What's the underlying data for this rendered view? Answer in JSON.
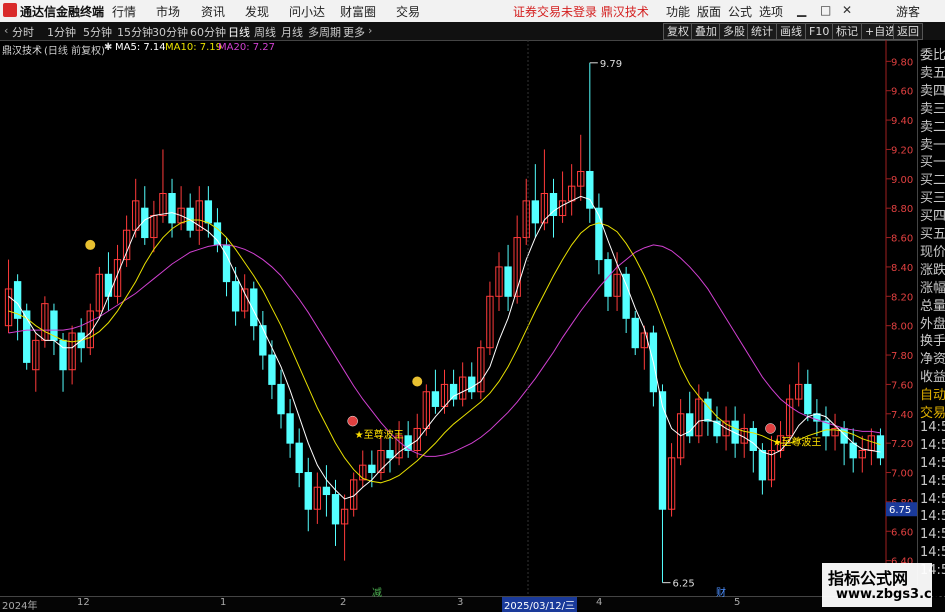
{
  "app": {
    "name": "通达信金融终端",
    "notice": "证券交易未登录  鼎汉技术"
  },
  "menu": [
    "行情",
    "市场",
    "资讯",
    "发现",
    "问小达",
    "财富圈",
    "交易"
  ],
  "right_menu": [
    "功能",
    "版面",
    "公式",
    "选项"
  ],
  "guest_label": "游客",
  "periods": [
    "分时",
    "1分钟",
    "5分钟",
    "15分钟",
    "30分钟",
    "60分钟",
    "日线",
    "周线",
    "月线",
    "多周期",
    "更多"
  ],
  "active_period": "日线",
  "tool_buttons": [
    "复权",
    "叠加",
    "多股",
    "统计",
    "画线",
    "F10",
    "标记",
    "+自选",
    "返回"
  ],
  "indicator": {
    "stock": "鼎汉技术",
    "mode": "(日线 前复权)",
    "ma5": "MA5: 7.14",
    "ma10": "MA10: 7.19",
    "ma20": "MA20: 7.27"
  },
  "colors": {
    "up": "#ff3b3b",
    "down": "#54ffff",
    "ma5": "#ffffff",
    "ma10": "#e8e000",
    "ma20": "#d040d0",
    "axis": "#e04040"
  },
  "price_axis": [
    "9.80",
    "9.60",
    "9.40",
    "9.20",
    "9.00",
    "8.80",
    "8.60",
    "8.40",
    "8.20",
    "8.00",
    "7.80",
    "7.60",
    "7.40",
    "7.20",
    "7.00",
    "6.80",
    "6.60",
    "6.40",
    "6.20"
  ],
  "annotations": {
    "high": "9.79",
    "low": "6.25",
    "signal": "★至尊波王",
    "current_price": "6.75"
  },
  "side_panel": [
    "委比",
    "卖五",
    "卖四",
    "卖三",
    "卖二",
    "卖一",
    "买一",
    "买二",
    "买三",
    "买四",
    "买五",
    "现价",
    "涨跌",
    "涨幅",
    "总量",
    "外盘",
    "换手",
    "净资",
    "收益",
    "自动",
    "交易",
    "14:56",
    "14:56",
    "14:56",
    "14:56",
    "14:56",
    "14:56",
    "14:56",
    "14:56",
    "14:56"
  ],
  "bottom_dates": [
    "2024年",
    "12",
    "1",
    "2",
    "3",
    "2025/03/12/三",
    "4",
    "5"
  ],
  "bottom_marks": [
    "减",
    "财"
  ],
  "watermark": {
    "line1": "指标公式网",
    "line2": "www.zbgs3.com"
  },
  "chart_data": {
    "type": "candlestick",
    "ylim": [
      6.2,
      9.85
    ],
    "series_names": [
      "MA5",
      "MA10",
      "MA20"
    ],
    "candles": [
      [
        8.0,
        8.25,
        8.45,
        7.95
      ],
      [
        8.3,
        8.05,
        8.35,
        7.9
      ],
      [
        8.1,
        7.75,
        8.15,
        7.7
      ],
      [
        7.7,
        7.9,
        7.95,
        7.55
      ],
      [
        7.9,
        8.15,
        8.2,
        7.85
      ],
      [
        8.1,
        7.9,
        8.15,
        7.8
      ],
      [
        7.9,
        7.7,
        7.95,
        7.55
      ],
      [
        7.7,
        7.95,
        8.0,
        7.6
      ],
      [
        7.95,
        7.85,
        8.05,
        7.75
      ],
      [
        7.85,
        8.1,
        8.15,
        7.8
      ],
      [
        8.1,
        8.35,
        8.4,
        8.05
      ],
      [
        8.35,
        8.2,
        8.5,
        8.1
      ],
      [
        8.2,
        8.45,
        8.55,
        8.15
      ],
      [
        8.45,
        8.65,
        8.75,
        8.4
      ],
      [
        8.65,
        8.85,
        9.0,
        8.6
      ],
      [
        8.8,
        8.6,
        8.95,
        8.55
      ],
      [
        8.6,
        8.75,
        8.85,
        8.5
      ],
      [
        8.75,
        8.9,
        9.2,
        8.7
      ],
      [
        8.9,
        8.7,
        9.0,
        8.6
      ],
      [
        8.7,
        8.8,
        8.95,
        8.65
      ],
      [
        8.8,
        8.65,
        8.9,
        8.6
      ],
      [
        8.65,
        8.85,
        8.95,
        8.55
      ],
      [
        8.85,
        8.7,
        8.95,
        8.6
      ],
      [
        8.7,
        8.55,
        8.8,
        8.5
      ],
      [
        8.55,
        8.3,
        8.6,
        8.2
      ],
      [
        8.3,
        8.1,
        8.4,
        8.0
      ],
      [
        8.1,
        8.25,
        8.35,
        8.05
      ],
      [
        8.25,
        8.0,
        8.3,
        7.9
      ],
      [
        8.0,
        7.8,
        8.1,
        7.7
      ],
      [
        7.8,
        7.6,
        7.9,
        7.5
      ],
      [
        7.6,
        7.4,
        7.7,
        7.3
      ],
      [
        7.4,
        7.2,
        7.5,
        7.1
      ],
      [
        7.2,
        7.0,
        7.3,
        6.9
      ],
      [
        7.0,
        6.75,
        7.1,
        6.6
      ],
      [
        6.75,
        6.9,
        7.0,
        6.65
      ],
      [
        6.9,
        6.85,
        7.05,
        6.7
      ],
      [
        6.85,
        6.65,
        6.95,
        6.5
      ],
      [
        6.65,
        6.75,
        6.85,
        6.4
      ],
      [
        6.75,
        6.95,
        7.0,
        6.7
      ],
      [
        6.95,
        7.05,
        7.15,
        6.9
      ],
      [
        7.05,
        7.0,
        7.15,
        6.9
      ],
      [
        7.0,
        7.15,
        7.25,
        6.95
      ],
      [
        7.15,
        7.1,
        7.25,
        7.0
      ],
      [
        7.1,
        7.25,
        7.35,
        7.05
      ],
      [
        7.25,
        7.15,
        7.35,
        7.1
      ],
      [
        7.15,
        7.3,
        7.4,
        7.1
      ],
      [
        7.3,
        7.55,
        7.6,
        7.25
      ],
      [
        7.55,
        7.45,
        7.7,
        7.4
      ],
      [
        7.45,
        7.6,
        7.7,
        7.4
      ],
      [
        7.6,
        7.5,
        7.7,
        7.45
      ],
      [
        7.5,
        7.65,
        7.75,
        7.45
      ],
      [
        7.65,
        7.55,
        7.75,
        7.5
      ],
      [
        7.55,
        7.85,
        7.9,
        7.5
      ],
      [
        7.85,
        8.2,
        8.3,
        7.8
      ],
      [
        8.2,
        8.4,
        8.5,
        8.1
      ],
      [
        8.4,
        8.2,
        8.55,
        8.1
      ],
      [
        8.2,
        8.6,
        8.75,
        8.15
      ],
      [
        8.6,
        8.85,
        9.0,
        8.55
      ],
      [
        8.85,
        8.7,
        9.1,
        8.6
      ],
      [
        8.7,
        8.9,
        9.2,
        8.65
      ],
      [
        8.9,
        8.75,
        9.0,
        8.6
      ],
      [
        8.75,
        8.85,
        9.05,
        8.7
      ],
      [
        8.85,
        8.95,
        9.1,
        8.75
      ],
      [
        8.95,
        9.05,
        9.3,
        8.85
      ],
      [
        9.05,
        8.8,
        9.79,
        8.7
      ],
      [
        8.8,
        8.45,
        8.9,
        8.35
      ],
      [
        8.45,
        8.2,
        8.5,
        8.1
      ],
      [
        8.2,
        8.35,
        8.5,
        8.1
      ],
      [
        8.35,
        8.05,
        8.4,
        7.95
      ],
      [
        8.05,
        7.85,
        8.1,
        7.8
      ],
      [
        7.85,
        7.95,
        8.0,
        7.7
      ],
      [
        7.95,
        7.55,
        8.0,
        7.45
      ],
      [
        7.55,
        6.75,
        7.6,
        6.25
      ],
      [
        6.75,
        7.1,
        7.2,
        6.7
      ],
      [
        7.1,
        7.4,
        7.5,
        7.05
      ],
      [
        7.4,
        7.25,
        7.55,
        7.2
      ],
      [
        7.25,
        7.5,
        7.6,
        7.2
      ],
      [
        7.5,
        7.35,
        7.55,
        7.25
      ],
      [
        7.35,
        7.25,
        7.45,
        7.2
      ],
      [
        7.25,
        7.35,
        7.45,
        7.15
      ],
      [
        7.35,
        7.2,
        7.45,
        7.1
      ],
      [
        7.2,
        7.3,
        7.4,
        7.1
      ],
      [
        7.3,
        7.15,
        7.35,
        7.0
      ],
      [
        7.15,
        6.95,
        7.2,
        6.85
      ],
      [
        6.95,
        7.15,
        7.25,
        6.9
      ],
      [
        7.15,
        7.25,
        7.35,
        7.1
      ],
      [
        7.25,
        7.5,
        7.6,
        7.2
      ],
      [
        7.5,
        7.6,
        7.75,
        7.45
      ],
      [
        7.6,
        7.4,
        7.7,
        7.35
      ],
      [
        7.4,
        7.35,
        7.5,
        7.25
      ],
      [
        7.35,
        7.25,
        7.45,
        7.15
      ],
      [
        7.25,
        7.3,
        7.4,
        7.15
      ],
      [
        7.3,
        7.2,
        7.35,
        7.05
      ],
      [
        7.2,
        7.1,
        7.3,
        7.0
      ],
      [
        7.1,
        7.15,
        7.25,
        7.0
      ],
      [
        7.15,
        7.25,
        7.3,
        7.05
      ],
      [
        7.25,
        7.1,
        7.3,
        7.05
      ]
    ],
    "ma5": [
      8.2,
      8.15,
      8.05,
      7.95,
      7.9,
      7.9,
      7.85,
      7.85,
      7.9,
      7.95,
      8.05,
      8.2,
      8.35,
      8.5,
      8.65,
      8.72,
      8.75,
      8.76,
      8.77,
      8.75,
      8.72,
      8.68,
      8.64,
      8.58,
      8.48,
      8.35,
      8.22,
      8.1,
      7.98,
      7.85,
      7.72,
      7.56,
      7.38,
      7.2,
      7.05,
      6.95,
      6.88,
      6.82,
      6.84,
      6.9,
      6.95,
      7.02,
      7.08,
      7.14,
      7.18,
      7.22,
      7.3,
      7.38,
      7.45,
      7.52,
      7.55,
      7.58,
      7.62,
      7.72,
      7.9,
      8.05,
      8.25,
      8.45,
      8.6,
      8.72,
      8.78,
      8.82,
      8.85,
      8.88,
      8.86,
      8.75,
      8.58,
      8.42,
      8.28,
      8.12,
      7.98,
      7.75,
      7.45,
      7.3,
      7.25,
      7.28,
      7.35,
      7.36,
      7.34,
      7.3,
      7.27,
      7.24,
      7.2,
      7.14,
      7.12,
      7.15,
      7.22,
      7.32,
      7.38,
      7.4,
      7.38,
      7.32,
      7.26,
      7.2,
      7.16,
      7.15,
      7.14
    ],
    "ma10": [
      8.1,
      8.08,
      8.05,
      8.0,
      7.96,
      7.93,
      7.9,
      7.89,
      7.9,
      7.92,
      7.96,
      8.02,
      8.1,
      8.2,
      8.3,
      8.42,
      8.52,
      8.6,
      8.66,
      8.7,
      8.72,
      8.72,
      8.7,
      8.66,
      8.6,
      8.52,
      8.43,
      8.34,
      8.24,
      8.12,
      8.0,
      7.86,
      7.72,
      7.58,
      7.44,
      7.32,
      7.2,
      7.1,
      7.02,
      6.96,
      6.94,
      6.93,
      6.95,
      6.98,
      7.03,
      7.08,
      7.14,
      7.2,
      7.27,
      7.33,
      7.38,
      7.43,
      7.48,
      7.54,
      7.62,
      7.72,
      7.84,
      7.97,
      8.1,
      8.22,
      8.34,
      8.45,
      8.55,
      8.63,
      8.68,
      8.7,
      8.68,
      8.64,
      8.56,
      8.46,
      8.34,
      8.2,
      8.04,
      7.88,
      7.72,
      7.6,
      7.52,
      7.45,
      7.38,
      7.33,
      7.3,
      7.28,
      7.27,
      7.25,
      7.22,
      7.2,
      7.2,
      7.22,
      7.25,
      7.27,
      7.29,
      7.29,
      7.28,
      7.26,
      7.23,
      7.21,
      7.19
    ],
    "ma20": [
      7.95,
      7.96,
      7.97,
      7.97,
      7.97,
      7.97,
      7.97,
      7.98,
      8.0,
      8.03,
      8.06,
      8.1,
      8.14,
      8.18,
      8.22,
      8.27,
      8.32,
      8.37,
      8.42,
      8.46,
      8.5,
      8.52,
      8.54,
      8.55,
      8.55,
      8.54,
      8.52,
      8.49,
      8.45,
      8.4,
      8.34,
      8.26,
      8.18,
      8.09,
      7.99,
      7.89,
      7.79,
      7.69,
      7.59,
      7.5,
      7.42,
      7.34,
      7.27,
      7.21,
      7.16,
      7.13,
      7.11,
      7.11,
      7.12,
      7.14,
      7.17,
      7.2,
      7.24,
      7.29,
      7.35,
      7.41,
      7.48,
      7.56,
      7.64,
      7.73,
      7.82,
      7.92,
      8.01,
      8.1,
      8.18,
      8.26,
      8.33,
      8.4,
      8.45,
      8.5,
      8.53,
      8.55,
      8.54,
      8.51,
      8.46,
      8.4,
      8.33,
      8.25,
      8.15,
      8.05,
      7.95,
      7.85,
      7.75,
      7.65,
      7.57,
      7.5,
      7.45,
      7.41,
      7.38,
      7.36,
      7.34,
      7.32,
      7.3,
      7.29,
      7.28,
      7.28,
      7.27
    ]
  }
}
